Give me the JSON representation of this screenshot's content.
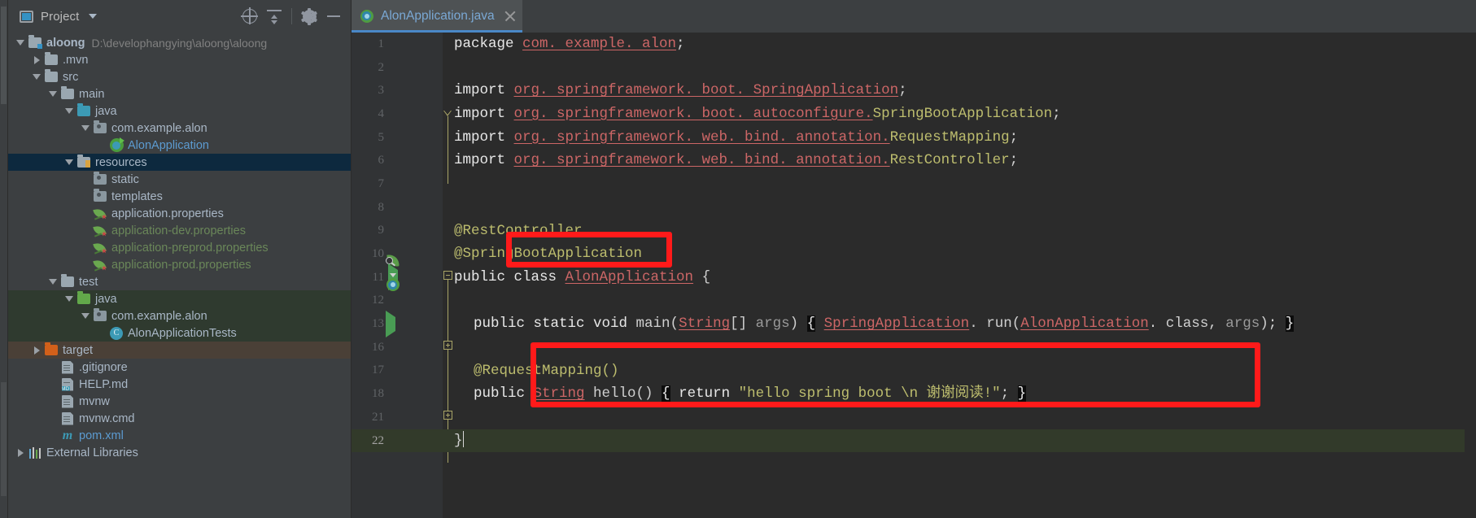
{
  "project_panel": {
    "title": "Project",
    "title_icon": "project-window-icon",
    "dropdown_icon": "chevron-down-icon",
    "actions": [
      {
        "name": "locate-icon",
        "tooltip": "Select Opened File"
      },
      {
        "name": "collapse-all-icon",
        "tooltip": "Collapse All"
      },
      {
        "name": "gear-icon",
        "tooltip": "Settings"
      },
      {
        "name": "minimize-icon",
        "tooltip": "Hide"
      }
    ],
    "tree": [
      {
        "label": "aloong",
        "path": "D:\\develophangying\\aloong\\aloong",
        "indent": 0,
        "twisty": "down",
        "icon": "module-folder-icon",
        "bold": true,
        "color": "default",
        "row_bg": "none"
      },
      {
        "label": ".mvn",
        "path": "",
        "indent": 1,
        "twisty": "right",
        "icon": "folder-icon",
        "bold": false,
        "color": "default",
        "row_bg": "none"
      },
      {
        "label": "src",
        "path": "",
        "indent": 1,
        "twisty": "down",
        "icon": "folder-icon",
        "bold": false,
        "color": "default",
        "row_bg": "none"
      },
      {
        "label": "main",
        "path": "",
        "indent": 2,
        "twisty": "down",
        "icon": "folder-icon",
        "bold": false,
        "color": "default",
        "row_bg": "none"
      },
      {
        "label": "java",
        "path": "",
        "indent": 3,
        "twisty": "down",
        "icon": "source-root-icon",
        "bold": false,
        "color": "default",
        "row_bg": "none"
      },
      {
        "label": "com.example.alon",
        "path": "",
        "indent": 4,
        "twisty": "down",
        "icon": "package-icon",
        "bold": false,
        "color": "default",
        "row_bg": "none"
      },
      {
        "label": "AlonApplication",
        "path": "",
        "indent": 5,
        "twisty": "none",
        "icon": "spring-class-icon",
        "bold": false,
        "color": "blue",
        "row_bg": "none"
      },
      {
        "label": "resources",
        "path": "",
        "indent": 3,
        "twisty": "down",
        "icon": "resource-root-icon",
        "bold": false,
        "color": "default",
        "row_bg": "selected"
      },
      {
        "label": "static",
        "path": "",
        "indent": 4,
        "twisty": "none",
        "icon": "package-icon",
        "bold": false,
        "color": "default",
        "row_bg": "none"
      },
      {
        "label": "templates",
        "path": "",
        "indent": 4,
        "twisty": "none",
        "icon": "package-icon",
        "bold": false,
        "color": "default",
        "row_bg": "none"
      },
      {
        "label": "application.properties",
        "path": "",
        "indent": 4,
        "twisty": "none",
        "icon": "spring-properties-icon",
        "bold": false,
        "color": "default",
        "row_bg": "none"
      },
      {
        "label": "application-dev.properties",
        "path": "",
        "indent": 4,
        "twisty": "none",
        "icon": "spring-properties-icon",
        "bold": false,
        "color": "green",
        "row_bg": "none"
      },
      {
        "label": "application-preprod.properties",
        "path": "",
        "indent": 4,
        "twisty": "none",
        "icon": "spring-properties-icon",
        "bold": false,
        "color": "green",
        "row_bg": "none"
      },
      {
        "label": "application-prod.properties",
        "path": "",
        "indent": 4,
        "twisty": "none",
        "icon": "spring-properties-icon",
        "bold": false,
        "color": "green",
        "row_bg": "none"
      },
      {
        "label": "test",
        "path": "",
        "indent": 2,
        "twisty": "down",
        "icon": "folder-icon",
        "bold": false,
        "color": "default",
        "row_bg": "none"
      },
      {
        "label": "java",
        "path": "",
        "indent": 3,
        "twisty": "down",
        "icon": "test-root-icon",
        "bold": false,
        "color": "default",
        "row_bg": "testsrc"
      },
      {
        "label": "com.example.alon",
        "path": "",
        "indent": 4,
        "twisty": "down",
        "icon": "package-icon",
        "bold": false,
        "color": "default",
        "row_bg": "testsrc"
      },
      {
        "label": "AlonApplicationTests",
        "path": "",
        "indent": 5,
        "twisty": "none",
        "icon": "class-icon",
        "bold": false,
        "color": "default",
        "row_bg": "testsrc"
      },
      {
        "label": "target",
        "path": "",
        "indent": 1,
        "twisty": "right",
        "icon": "excluded-folder-icon",
        "bold": false,
        "color": "default",
        "row_bg": "excluded"
      },
      {
        "label": ".gitignore",
        "path": "",
        "indent": 2,
        "twisty": "none",
        "icon": "file-icon",
        "bold": false,
        "color": "default",
        "row_bg": "none"
      },
      {
        "label": "HELP.md",
        "path": "",
        "indent": 2,
        "twisty": "none",
        "icon": "markdown-file-icon",
        "bold": false,
        "color": "default",
        "row_bg": "none"
      },
      {
        "label": "mvnw",
        "path": "",
        "indent": 2,
        "twisty": "none",
        "icon": "file-icon",
        "bold": false,
        "color": "default",
        "row_bg": "none"
      },
      {
        "label": "mvnw.cmd",
        "path": "",
        "indent": 2,
        "twisty": "none",
        "icon": "file-icon",
        "bold": false,
        "color": "default",
        "row_bg": "none"
      },
      {
        "label": "pom.xml",
        "path": "",
        "indent": 2,
        "twisty": "none",
        "icon": "maven-file-icon",
        "bold": false,
        "color": "blue",
        "row_bg": "none"
      },
      {
        "label": "External Libraries",
        "path": "",
        "indent": 0,
        "twisty": "right",
        "icon": "libraries-icon",
        "bold": false,
        "color": "default",
        "row_bg": "none"
      }
    ]
  },
  "editor": {
    "tab": {
      "name": "AlonApplication.java",
      "icon": "spring-class-icon",
      "close_icon": "close-icon",
      "active": true
    },
    "accent_color": "#4a88c7",
    "line_numbers": [
      "1",
      "2",
      "3",
      "4",
      "5",
      "6",
      "7",
      "8",
      "9",
      "10",
      "11",
      "12",
      "13",
      "16",
      "17",
      "18",
      "21",
      "22"
    ],
    "caret_line": "22",
    "lines": [
      {
        "n": "1",
        "text": "package com.example.alon;"
      },
      {
        "n": "2",
        "text": ""
      },
      {
        "n": "3",
        "text": "import org.springframework.boot.SpringApplication;"
      },
      {
        "n": "4",
        "text": "import org.springframework.boot.autoconfigure.SpringBootApplication;"
      },
      {
        "n": "5",
        "text": "import org.springframework.web.bind.annotation.RequestMapping;"
      },
      {
        "n": "6",
        "text": "import org.springframework.web.bind.annotation.RestController;"
      },
      {
        "n": "7",
        "text": ""
      },
      {
        "n": "8",
        "text": ""
      },
      {
        "n": "9",
        "text": "@RestController"
      },
      {
        "n": "10",
        "text": "@SpringBootApplication"
      },
      {
        "n": "11",
        "text": "public class AlonApplication {"
      },
      {
        "n": "12",
        "text": ""
      },
      {
        "n": "13",
        "text": "public static void main(String[] args) { SpringApplication.run(AlonApplication.class, args); }"
      },
      {
        "n": "16",
        "text": ""
      },
      {
        "n": "17",
        "text": "@RequestMapping()"
      },
      {
        "n": "18",
        "text": "public String hello() { return \"hello spring boot \\n 谢谢阅读!\"; }"
      },
      {
        "n": "21",
        "text": ""
      },
      {
        "n": "22",
        "text": "}"
      }
    ],
    "gutter_icons": [
      {
        "line": "10",
        "icon": "spring-bean-gutter-icon"
      },
      {
        "line": "11",
        "icon": "spring-class-gutter-icon"
      },
      {
        "line": "11",
        "icon": "run-gutter-icon"
      },
      {
        "line": "13",
        "icon": "run-gutter-icon"
      }
    ],
    "annotations": [
      {
        "name": "rest-controller-highlight",
        "target": "@RestController",
        "color": "#ff1a1a"
      },
      {
        "name": "request-mapping-highlight",
        "target": "@RequestMapping() / hello()",
        "color": "#ff1a1a"
      }
    ],
    "code_tokens": {
      "l1": [
        [
          "kw",
          "package "
        ],
        [
          "pkg",
          "com. example. alon"
        ],
        [
          "pln",
          ";"
        ]
      ],
      "l3": [
        [
          "kw",
          "import "
        ],
        [
          "pkg",
          "org. springframework. boot. SpringApplication"
        ],
        [
          "pln",
          ";"
        ]
      ],
      "l4": [
        [
          "kw",
          "import "
        ],
        [
          "pkg",
          "org. springframework. boot. autoconfigure."
        ],
        [
          "cls",
          "SpringBootApplication"
        ],
        [
          "pln",
          ";"
        ]
      ],
      "l5": [
        [
          "kw",
          "import "
        ],
        [
          "pkg",
          "org. springframework. web. bind. annotation."
        ],
        [
          "cls",
          "RequestMapping"
        ],
        [
          "pln",
          ";"
        ]
      ],
      "l6": [
        [
          "kw",
          "import "
        ],
        [
          "pkg",
          "org. springframework. web. bind. annotation."
        ],
        [
          "cls",
          "RestController"
        ],
        [
          "pln",
          ";"
        ]
      ],
      "l9": [
        [
          "ann",
          "@RestController"
        ]
      ],
      "l10": [
        [
          "ann",
          "@SpringBootApplication"
        ]
      ],
      "l11": [
        [
          "kw",
          "public class "
        ],
        [
          "clsu",
          "AlonApplication"
        ],
        [
          "pln",
          " {"
        ]
      ],
      "l13": [
        [
          "kw",
          "public static void "
        ],
        [
          "pln",
          "main("
        ],
        [
          "clsu",
          "String"
        ],
        [
          "pln",
          "[] "
        ],
        [
          "param",
          "args"
        ],
        [
          "pln",
          ") "
        ],
        [
          "brace",
          "{"
        ],
        [
          "pln",
          " "
        ],
        [
          "clsu",
          "SpringApplication"
        ],
        [
          "pln",
          ". run("
        ],
        [
          "clsu",
          "AlonApplication"
        ],
        [
          "pln",
          ". class, "
        ],
        [
          "param",
          "args"
        ],
        [
          "pln",
          "); "
        ],
        [
          "brace",
          "}"
        ]
      ],
      "l17": [
        [
          "ann",
          "@RequestMapping()"
        ]
      ],
      "l18": [
        [
          "kw",
          "public "
        ],
        [
          "clsu",
          "String"
        ],
        [
          "pln",
          " hello() "
        ],
        [
          "brace",
          "{"
        ],
        [
          "kw",
          " return "
        ],
        [
          "str",
          "\"hello spring boot \\n 谢谢阅读!\""
        ],
        [
          "pln",
          "; "
        ],
        [
          "brace",
          "}"
        ]
      ],
      "l22": [
        [
          "pln",
          "}"
        ]
      ]
    }
  }
}
